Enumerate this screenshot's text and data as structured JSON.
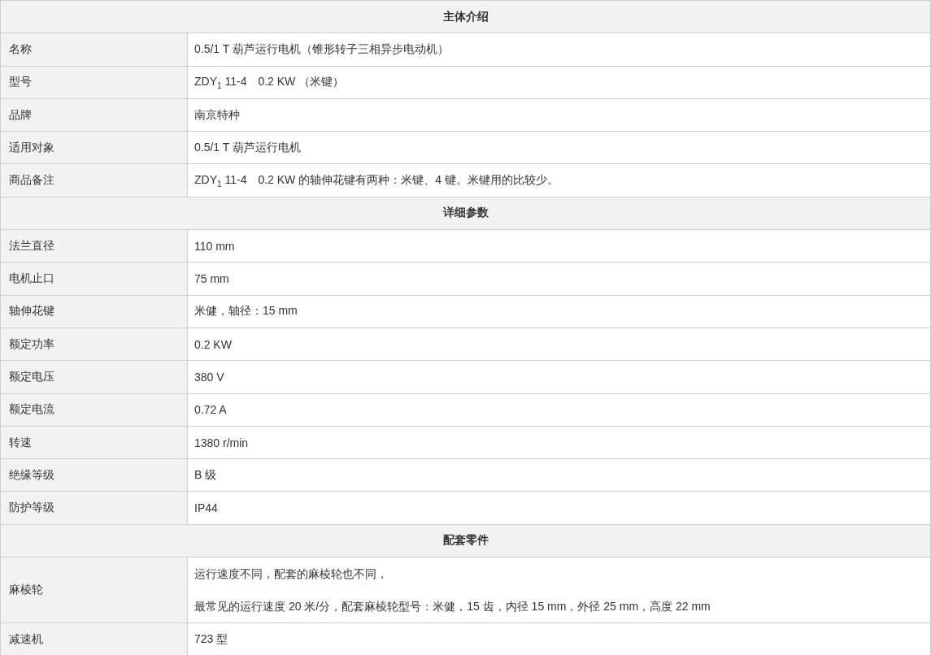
{
  "sections": [
    {
      "title": "主体介绍",
      "rows": [
        {
          "label": "名称",
          "value": "0.5/1 T 葫芦运行电机（锥形转子三相异步电动机）"
        },
        {
          "label": "型号",
          "value": "ZDY$_{1}$ 11-4　0.2 KW （米键）"
        },
        {
          "label": "品牌",
          "value": "南京特种"
        },
        {
          "label": "适用对象",
          "value": "0.5/1 T 葫芦运行电机"
        },
        {
          "label": "商品备注",
          "value": "ZDY$_{1}$ 11-4　0.2 KW 的轴伸花键有两种：米键、4 键。米键用的比较少。"
        }
      ]
    },
    {
      "title": "详细参数",
      "rows": [
        {
          "label": "法兰直径",
          "value": "110 mm"
        },
        {
          "label": "电机止口",
          "value": "75 mm"
        },
        {
          "label": "轴伸花键",
          "value": "米健，轴径：15 mm"
        },
        {
          "label": "额定功率",
          "value": "0.2 KW"
        },
        {
          "label": "额定电压",
          "value": "380 V"
        },
        {
          "label": "额定电流",
          "value": "0.72 A"
        },
        {
          "label": "转速",
          "value": "1380 r/min"
        },
        {
          "label": "绝缘等级",
          "value": "B 级"
        },
        {
          "label": "防护等级",
          "value": "IP44"
        }
      ]
    },
    {
      "title": "配套零件",
      "rows": [
        {
          "label": "麻棱轮",
          "lines": [
            "运行速度不同，配套的麻棱轮也不同，",
            "最常见的运行速度 20 米/分，配套麻棱轮型号：米健，15 齿，内径 15 mm，外径 25 mm，高度 22 mm"
          ]
        },
        {
          "label": "减速机",
          "value": "723 型"
        }
      ]
    }
  ]
}
